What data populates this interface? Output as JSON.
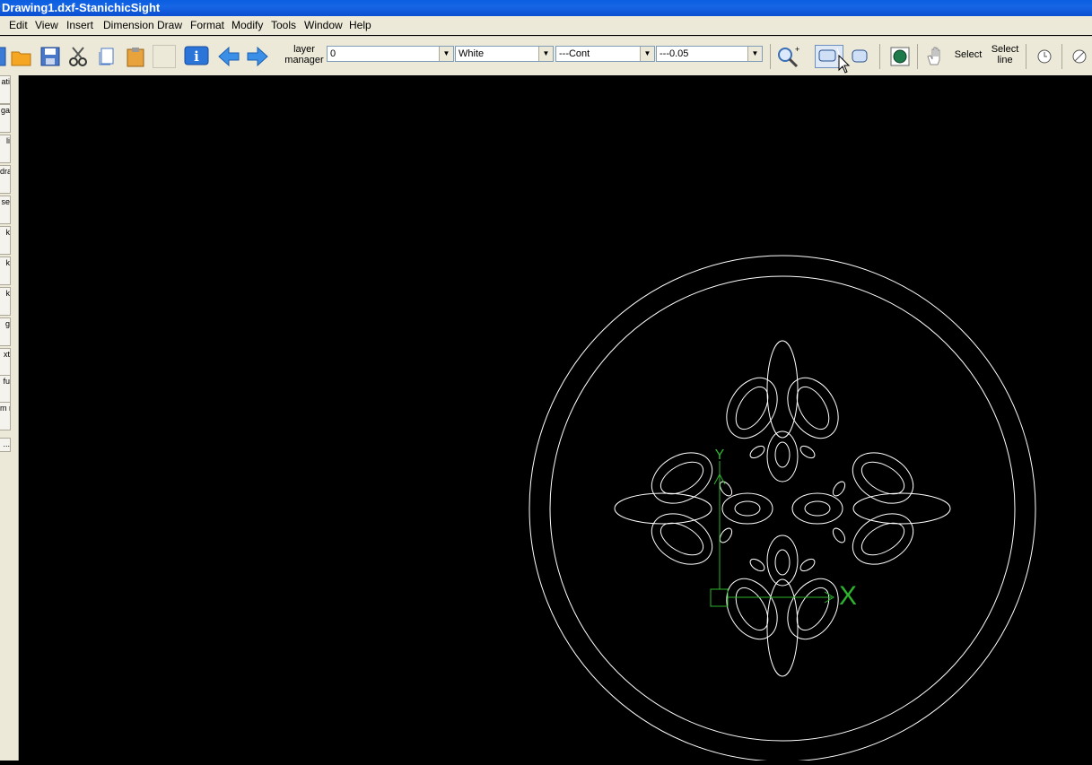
{
  "window": {
    "title": "Drawing1.dxf-StanichicSight"
  },
  "menu": [
    "Edit",
    "View",
    "Insert",
    "Dimension",
    "Draw",
    "Format",
    "Modify",
    "Tools",
    "Window",
    "Help"
  ],
  "toolbar": {
    "layer_manager_line1": "layer",
    "layer_manager_line2": "manager",
    "layer_value": "0",
    "color_value": "White",
    "linetype_value": "---Cont",
    "lineweight_value": "---0.05",
    "select_label": "Select",
    "select_line_line1": "Select",
    "select_line_line2": "line"
  },
  "left_toolbar": [
    "ati",
    "...",
    "ga",
    "li",
    "dra",
    "se",
    "k",
    "k",
    "k",
    "g",
    "xt",
    "fu",
    "m n"
  ],
  "canvas": {
    "background": "#000000",
    "geometry_color": "#ffffff",
    "ucs_color": "#2db52d",
    "ucs_x_label": "X",
    "ucs_y_label": "Y"
  }
}
